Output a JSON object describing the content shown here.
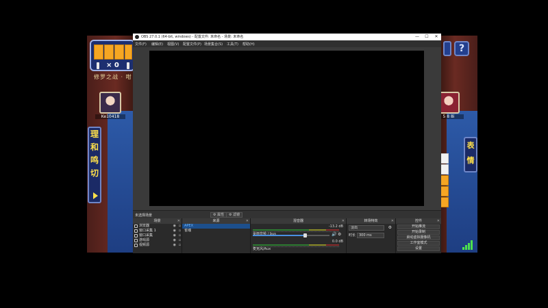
{
  "game": {
    "counter": "× 0",
    "mode_label": "修罗之战 · 咁",
    "left_player": {
      "name": "Ke10418",
      "score": ""
    },
    "right_player": {
      "name": "5 8 8i",
      "score": ""
    },
    "action_glyphs": [
      "理",
      "和",
      "鸣",
      "切"
    ],
    "emote_glyphs": [
      "表",
      "情"
    ],
    "help_label": "?"
  },
  "obs": {
    "title": "OBS 27.0.1 (64-bit, windows) - 配置文件: 未命名 - 场景: 未命名",
    "window_controls": {
      "minimize": "—",
      "maximize": "☐",
      "close": "✕"
    },
    "menu": [
      "文件(F)",
      "编辑(E)",
      "视图(V)",
      "配置文件(P)",
      "场景集合(S)",
      "工具(T)",
      "帮助(H)"
    ],
    "scene_bar": {
      "name": "未选择场景",
      "buttons": [
        "⚙ 属性",
        "⚙ 滤镜"
      ]
    },
    "docks": {
      "scenes": {
        "title": "场景",
        "items": [
          {
            "label": "APEX",
            "selected": true
          },
          {
            "label": "雀魂",
            "selected": false
          }
        ]
      },
      "sources": {
        "title": "来源",
        "items": [
          {
            "label": "浏览器",
            "icon": "browser-icon"
          },
          {
            "label": "窗口采集 1",
            "icon": "window-capture-icon"
          },
          {
            "label": "窗口采集",
            "icon": "window-capture-icon"
          },
          {
            "label": "游戏源",
            "icon": "game-capture-icon"
          },
          {
            "label": "视频源",
            "icon": "video-source-icon"
          }
        ]
      },
      "mixer": {
        "title": "混音器",
        "tracks": [
          {
            "label": "桌面音频 / bus",
            "db": "-13.2 dB",
            "level": 0.68
          },
          {
            "label": "麦克风/Aux",
            "db": "0.0 dB",
            "level": 0.0
          }
        ]
      },
      "transitions": {
        "title": "转场特效",
        "selected": "淡出",
        "duration_label": "时长",
        "duration_value": "300 ms"
      },
      "controls": {
        "title": "控件",
        "buttons": [
          "开始推流",
          "开始录制",
          "启动虚拟摄像机",
          "工作室模式",
          "设置"
        ]
      }
    }
  }
}
